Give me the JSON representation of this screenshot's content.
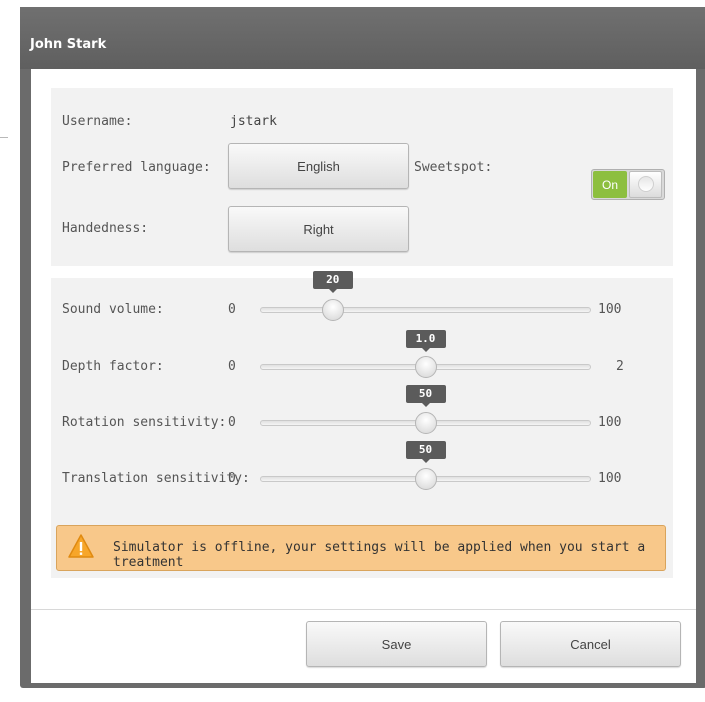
{
  "dialog": {
    "title": "John Stark"
  },
  "profile": {
    "username_label": "Username:",
    "username_value": "jstark",
    "language_label": "Preferred language:",
    "language_value": "English",
    "sweetspot_label": "Sweetspot:",
    "sweetspot_state": "On",
    "handedness_label": "Handedness:",
    "handedness_value": "Right"
  },
  "sliders": [
    {
      "label": "Sound volume:",
      "min": "0",
      "max": "100",
      "value": "20",
      "fraction": 0.2
    },
    {
      "label": "Depth factor:",
      "min": "0",
      "max": "2",
      "value": "1.0",
      "fraction": 0.5
    },
    {
      "label": "Rotation sensitivity:",
      "min": "0",
      "max": "100",
      "value": "50",
      "fraction": 0.5
    },
    {
      "label": "Translation sensitivity:",
      "min": "0",
      "max": "100",
      "value": "50",
      "fraction": 0.5
    }
  ],
  "warning": {
    "icon": "warning-icon",
    "text": "Simulator is offline, your settings will be applied when you start a treatment"
  },
  "footer": {
    "save_label": "Save",
    "cancel_label": "Cancel"
  },
  "colors": {
    "toggle_on": "#8dbf3f",
    "warning_bg": "#f8c88a",
    "titlebar": "#666666",
    "tooltip": "#5b5b5b"
  }
}
